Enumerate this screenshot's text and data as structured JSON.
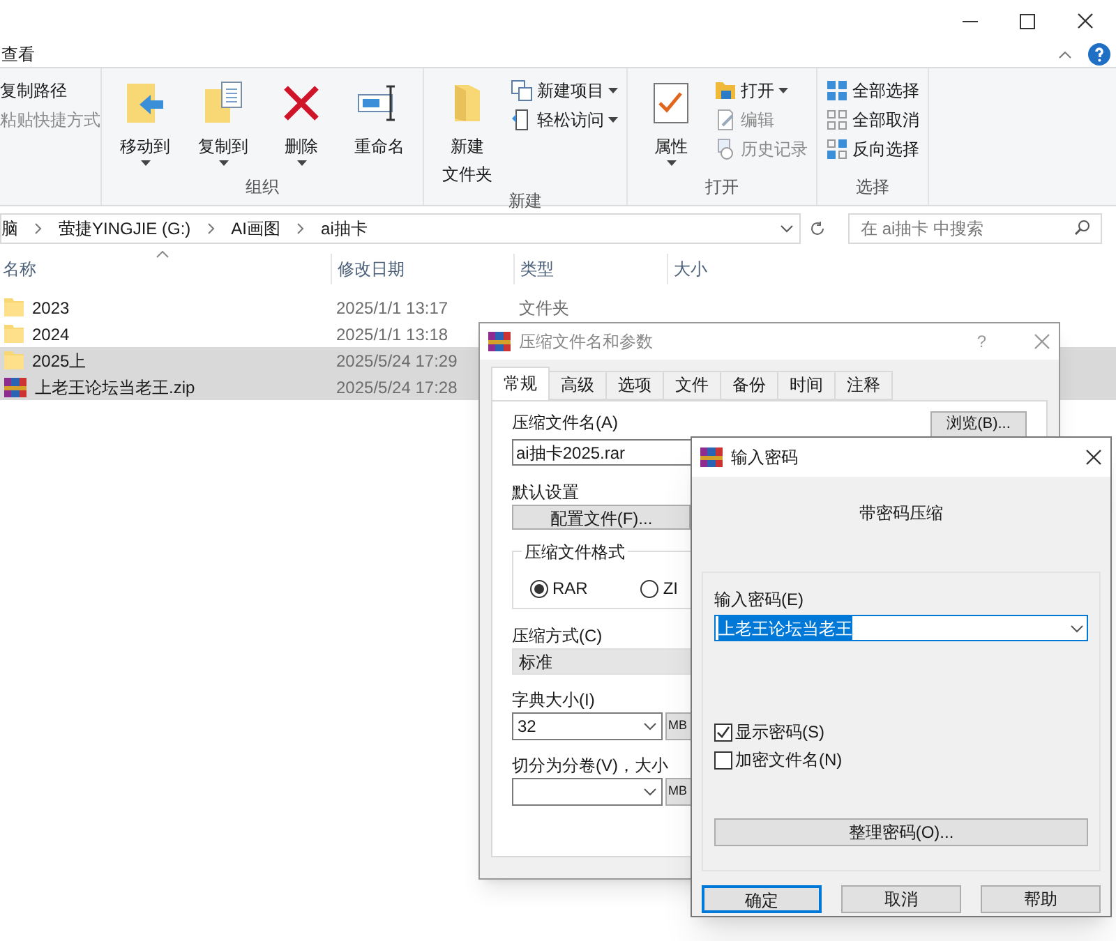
{
  "explorer": {
    "ribbon_tab": "查看",
    "groups": [
      {
        "items": [
          {
            "kind": "small",
            "label": "复制路径",
            "disabled": false
          },
          {
            "kind": "small",
            "label": "粘贴快捷方式",
            "disabled": true
          }
        ]
      },
      {
        "label": "组织",
        "items": [
          {
            "kind": "large",
            "label": [
              "移动到"
            ],
            "dropdown": true
          },
          {
            "kind": "large",
            "label": [
              "复制到"
            ],
            "dropdown": true
          },
          {
            "kind": "large",
            "label": [
              "删除"
            ],
            "dropdown": true
          },
          {
            "kind": "large",
            "label": [
              "重命名"
            ],
            "dropdown": false
          }
        ]
      },
      {
        "label": "新建",
        "items": [
          {
            "kind": "large",
            "label": [
              "新建",
              "文件夹"
            ],
            "dropdown": false
          },
          {
            "kind": "small",
            "label": "新建项目",
            "dropdown": true,
            "disabled": false
          },
          {
            "kind": "small",
            "label": "轻松访问",
            "dropdown": true,
            "disabled": false
          }
        ]
      },
      {
        "label": "打开",
        "items": [
          {
            "kind": "large",
            "label": [
              "属性"
            ],
            "dropdown": true
          },
          {
            "kind": "small",
            "label": "打开",
            "dropdown": true,
            "disabled": false
          },
          {
            "kind": "small",
            "label": "编辑",
            "dropdown": false,
            "disabled": true
          },
          {
            "kind": "small",
            "label": "历史记录",
            "dropdown": false,
            "disabled": true
          }
        ]
      },
      {
        "label": "选择",
        "items": [
          {
            "kind": "small",
            "label": "全部选择",
            "dropdown": false,
            "disabled": false
          },
          {
            "kind": "small",
            "label": "全部取消",
            "dropdown": false,
            "disabled": false
          },
          {
            "kind": "small",
            "label": "反向选择",
            "dropdown": false,
            "disabled": false
          }
        ]
      }
    ],
    "breadcrumbs": [
      "脑",
      "萤捷YINGJIE (G:)",
      "AI画图",
      "ai抽卡"
    ],
    "search": {
      "placeholder": "在 ai抽卡 中搜索"
    },
    "columns": [
      "名称",
      "修改日期",
      "类型",
      "大小"
    ],
    "rows": [
      {
        "kind": "folder",
        "name": "2023",
        "date": "2025/1/1 13:17",
        "type": "文件夹",
        "selected": false
      },
      {
        "kind": "folder",
        "name": "2024",
        "date": "2025/1/1 13:18",
        "selected": false
      },
      {
        "kind": "folder",
        "name": "2025上",
        "date": "2025/5/24 17:29",
        "selected": true
      },
      {
        "kind": "archive",
        "name": "上老王论坛当老王.zip",
        "date": "2025/5/24 17:28",
        "selected": true
      }
    ]
  },
  "archive_dialog": {
    "title": "压缩文件名和参数",
    "help": "?",
    "tabs": [
      {
        "label": "常规",
        "selected": true
      },
      {
        "label": "高级",
        "selected": false
      },
      {
        "label": "选项",
        "selected": false
      },
      {
        "label": "文件",
        "selected": false
      },
      {
        "label": "备份",
        "selected": false
      },
      {
        "label": "时间",
        "selected": false
      },
      {
        "label": "注释",
        "selected": false
      }
    ],
    "name_label": "压缩文件名(A)",
    "name_value": "ai抽卡2025.rar",
    "browse": "浏览(B)...",
    "defaults_label": "默认设置",
    "profiles": "配置文件(F)...",
    "format_label": "压缩文件格式",
    "formats": [
      {
        "label": "RAR",
        "selected": true
      },
      {
        "label": "ZI",
        "selected": false
      }
    ],
    "method_label": "压缩方式(C)",
    "method_value": "标准",
    "dict_label": "字典大小(I)",
    "dict_value": "32",
    "dict_unit": "MB",
    "split_label": "切分为分卷(V)，大小",
    "split_unit": "MB"
  },
  "password_dialog": {
    "title": "输入密码",
    "heading": "带密码压缩",
    "label": "输入密码(E)",
    "value": "上老王论坛当老王",
    "value_selected": true,
    "checkboxes": [
      {
        "label": "显示密码(S)",
        "checked": true
      },
      {
        "label": "加密文件名(N)",
        "checked": false
      }
    ],
    "organize": "整理密码(O)...",
    "buttons": [
      {
        "label": "确定",
        "default": true
      },
      {
        "label": "取消",
        "default": false
      },
      {
        "label": "帮助",
        "default": false
      }
    ]
  }
}
